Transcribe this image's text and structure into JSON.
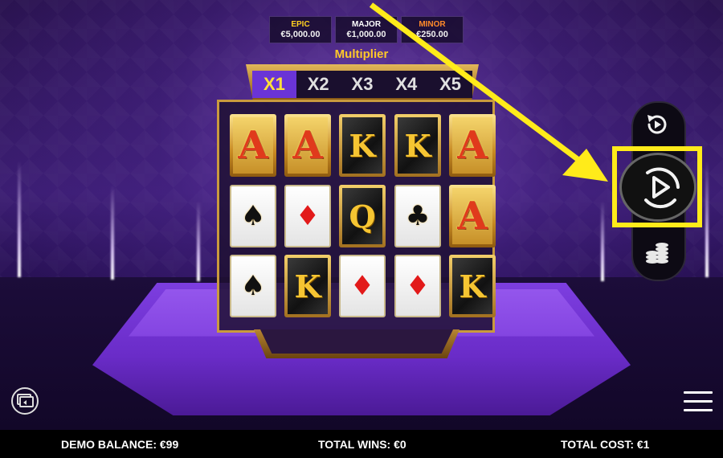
{
  "jackpots": [
    {
      "name": "EPIC",
      "amount": "€5,000.00",
      "color": "#ffd020"
    },
    {
      "name": "MAJOR",
      "amount": "€1,000.00",
      "color": "#ffffff"
    },
    {
      "name": "MINOR",
      "amount": "€250.00",
      "color": "#ff8a2a"
    }
  ],
  "multiplier": {
    "title": "Multiplier",
    "options": [
      "X1",
      "X2",
      "X3",
      "X4",
      "X5"
    ],
    "active": "X1"
  },
  "grid": {
    "rows": [
      [
        {
          "symbol": "A",
          "style": "gold"
        },
        {
          "symbol": "A",
          "style": "gold"
        },
        {
          "symbol": "K",
          "style": "black"
        },
        {
          "symbol": "K",
          "style": "black"
        },
        {
          "symbol": "A",
          "style": "gold"
        }
      ],
      [
        {
          "symbol": "♠",
          "style": "white-spade"
        },
        {
          "symbol": "♦",
          "style": "white-diamond"
        },
        {
          "symbol": "Q",
          "style": "black"
        },
        {
          "symbol": "♣",
          "style": "white-club"
        },
        {
          "symbol": "A",
          "style": "gold"
        }
      ],
      [
        {
          "symbol": "♠",
          "style": "white-spade"
        },
        {
          "symbol": "K",
          "style": "black"
        },
        {
          "symbol": "♦",
          "style": "white-diamond"
        },
        {
          "symbol": "♦",
          "style": "white-diamond"
        },
        {
          "symbol": "K",
          "style": "black"
        }
      ]
    ]
  },
  "controls": {
    "autoplay_icon": "autoplay-icon",
    "spin_icon": "play-icon",
    "bet_icon": "coin-stack-icon",
    "history_icon": "card-history-icon",
    "menu_icon": "hamburger-menu-icon",
    "highlight_color": "#ffeb1a"
  },
  "status_bar": {
    "balance": "DEMO BALANCE: €99",
    "wins": "TOTAL WINS: €0",
    "cost": "TOTAL COST: €1"
  }
}
